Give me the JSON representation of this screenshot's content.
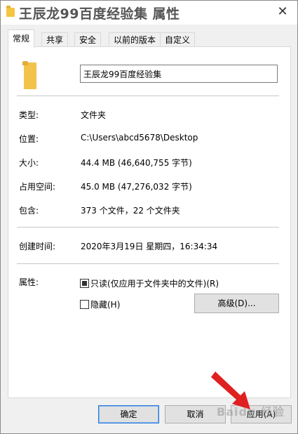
{
  "window": {
    "title": "王辰龙99百度经验集 属性",
    "close_glyph": "✕"
  },
  "tabs": [
    "常规",
    "共享",
    "安全",
    "以前的版本",
    "自定义"
  ],
  "general": {
    "name_value": "王辰龙99百度经验集",
    "rows": [
      {
        "label": "类型:",
        "value": "文件夹"
      },
      {
        "label": "位置:",
        "value": "C:\\Users\\abcd5678\\Desktop"
      },
      {
        "label": "大小:",
        "value": "44.4 MB (46,640,755 字节)"
      },
      {
        "label": "占用空间:",
        "value": "45.0 MB (47,276,032 字节)"
      },
      {
        "label": "包含:",
        "value": "373 个文件，22 个文件夹"
      }
    ],
    "created": {
      "label": "创建时间:",
      "value": "2020年3月19日 星期四，16:34:34"
    },
    "attributes": {
      "label": "属性:",
      "readonly_label": "只读(仅应用于文件夹中的文件)(R)",
      "readonly_checked": true,
      "hidden_label": "隐藏(H)",
      "hidden_checked": false,
      "advanced_button": "高级(D)..."
    }
  },
  "footer": {
    "ok": "确定",
    "cancel": "取消",
    "apply": "应用(A)"
  },
  "watermark": "Baidu 经验",
  "colors": {
    "folder": "#f2c24a",
    "arrow": "#e02020",
    "default_button_border": "#2b7bd7"
  }
}
